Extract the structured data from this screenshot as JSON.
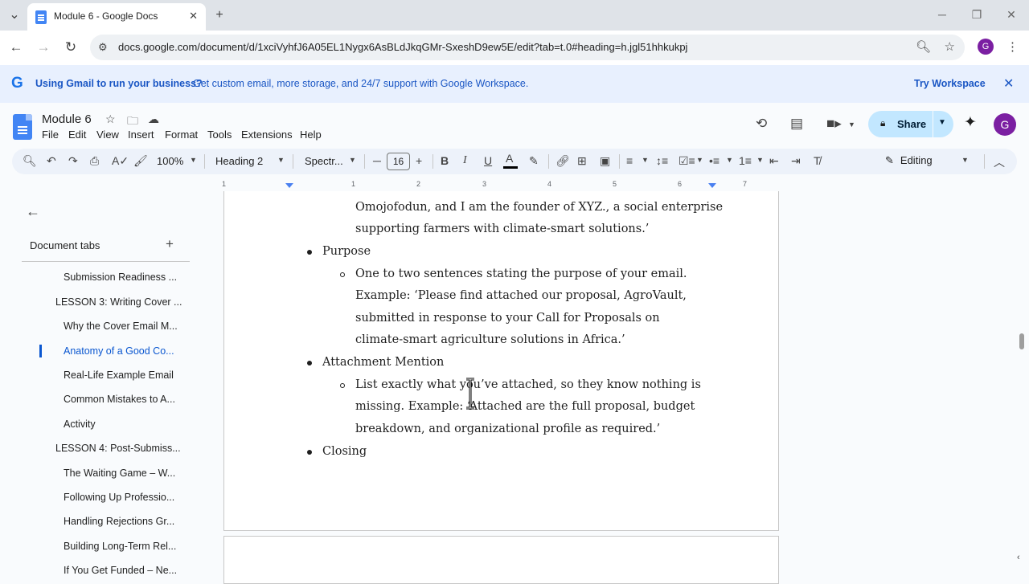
{
  "browser": {
    "tab_title": "Module 6 - Google Docs",
    "url": "docs.google.com/document/d/1xciVyhfJ6A05EL1Nygx6AsBLdJkqGMr-SxeshD9ew5E/edit?tab=t.0#heading=h.jgl51hhkukpj",
    "profile_initial": "G"
  },
  "banner": {
    "bold_text": "Using Gmail to run your business?",
    "text": "Get custom email, more storage, and 24/7 support with Google Workspace.",
    "cta": "Try Workspace"
  },
  "doc": {
    "title": "Module 6",
    "menu": [
      "File",
      "Edit",
      "View",
      "Insert",
      "Format",
      "Tools",
      "Extensions",
      "Help"
    ],
    "share_label": "Share",
    "user_initial": "G"
  },
  "format_toolbar": {
    "zoom": "100%",
    "style": "Heading 2",
    "font": "Spectr...",
    "font_size": "16",
    "mode": "Editing"
  },
  "sidebar": {
    "header": "Document tabs",
    "items": [
      "Submission Readiness ...",
      "LESSON 3: Writing Cover ...",
      "Why the Cover Email M...",
      "Anatomy of a Good Co...",
      "Real-Life Example Email",
      "Common Mistakes to A...",
      "Activity",
      "LESSON 4: Post-Submiss...",
      "The Waiting Game – W...",
      "Following Up Professio...",
      "Handling Rejections Gr...",
      "Building Long-Term Rel...",
      "If You Get Funded – Ne..."
    ]
  },
  "ruler": {
    "numbers": [
      "1",
      "1",
      "2",
      "3",
      "4",
      "5",
      "6",
      "7"
    ]
  },
  "body": {
    "lines": [
      "Omojofodun, and I am the founder of XYZ., a social enterprise",
      "supporting farmers with climate-smart solutions.’",
      "Purpose",
      "One to two sentences stating the purpose of your email.",
      "Example: ‘Please find attached our proposal, AgroVault,",
      "submitted in response to your Call for Proposals on",
      "climate-smart agriculture solutions in Africa.’",
      "Attachment Mention",
      "List exactly what you’ve attached, so they know nothing is",
      "missing. Example: ‘Attached are the full proposal, budget",
      "breakdown, and organizational profile as required.’",
      "Closing"
    ]
  },
  "colors": {
    "accent": "#0b57d0",
    "share_bg": "#c2e7ff",
    "banner_bg": "#e8f0fe",
    "profile": "#7b1fa2"
  }
}
